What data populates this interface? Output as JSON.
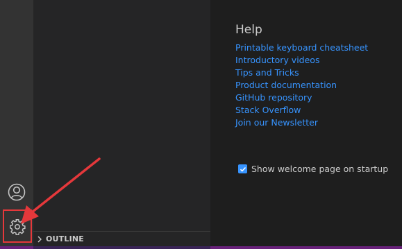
{
  "icons": {
    "account": "account-icon",
    "settings": "gear-icon",
    "outline_chevron": "chevron-right-icon",
    "checkbox": "checkmark-icon"
  },
  "sidebar": {
    "outline_label": "OUTLINE"
  },
  "welcome": {
    "help_title": "Help",
    "help_links": [
      "Printable keyboard cheatsheet",
      "Introductory videos",
      "Tips and Tricks",
      "Product documentation",
      "GitHub repository",
      "Stack Overflow",
      "Join our Newsletter"
    ],
    "startup_checkbox_label": "Show welcome page on startup",
    "startup_checked": true
  },
  "colors": {
    "activitybar": "#333333",
    "sidebar": "#252526",
    "editor": "#1e1e1e",
    "link": "#3794ff",
    "annotation": "#e5383b"
  }
}
